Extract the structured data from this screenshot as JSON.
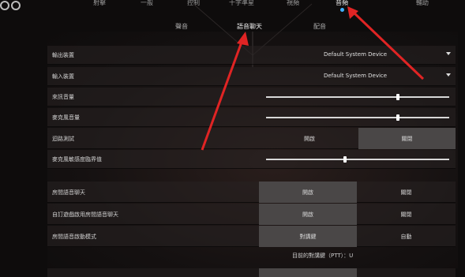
{
  "top_nav": {
    "tabs": [
      {
        "label": "射擊"
      },
      {
        "label": "一般"
      },
      {
        "label": "控制"
      },
      {
        "label": "十字準星"
      },
      {
        "label": "視頻"
      },
      {
        "label": "音頻"
      },
      {
        "label": "輔助"
      }
    ],
    "active_tab": "音頻"
  },
  "sub_tabs": {
    "tabs": [
      {
        "label": "聲音"
      },
      {
        "label": "語音聊天"
      },
      {
        "label": "配音"
      }
    ],
    "active": "語音聊天"
  },
  "settings": {
    "output_device": {
      "label": "輸出裝置",
      "value": "Default System Device"
    },
    "input_device": {
      "label": "輸入裝置",
      "value": "Default System Device"
    },
    "incoming_volume": {
      "label": "來訊音量",
      "level": 0.72
    },
    "mic_volume": {
      "label": "麥克風音量",
      "level": 0.72
    },
    "loopback_test": {
      "label": "迴路測試",
      "on_label": "開啟",
      "off_label": "關閉",
      "selected": "off"
    },
    "mic_sensitivity": {
      "label": "麥克風敏感度臨界值",
      "level": 0.43
    },
    "party_voice": {
      "label": "房間語音聊天",
      "on_label": "開啟",
      "off_label": "關閉",
      "selected": "on"
    },
    "auto_join_party_voice": {
      "label": "自訂遊戲啟用房間語音聊天",
      "on_label": "開啟",
      "off_label": "關閉",
      "selected": "on"
    },
    "party_voice_mode": {
      "label": "房間語音啟動模式",
      "on_label": "對講鍵",
      "off_label": "自動",
      "selected": "on"
    }
  },
  "footer": {
    "ptt_text": "目前的對講鍵（PTT）：U"
  },
  "colors": {
    "accent": "#3fb0ff",
    "annotation_arrow": "#e02424",
    "selected_toggle": "#4a4747"
  }
}
